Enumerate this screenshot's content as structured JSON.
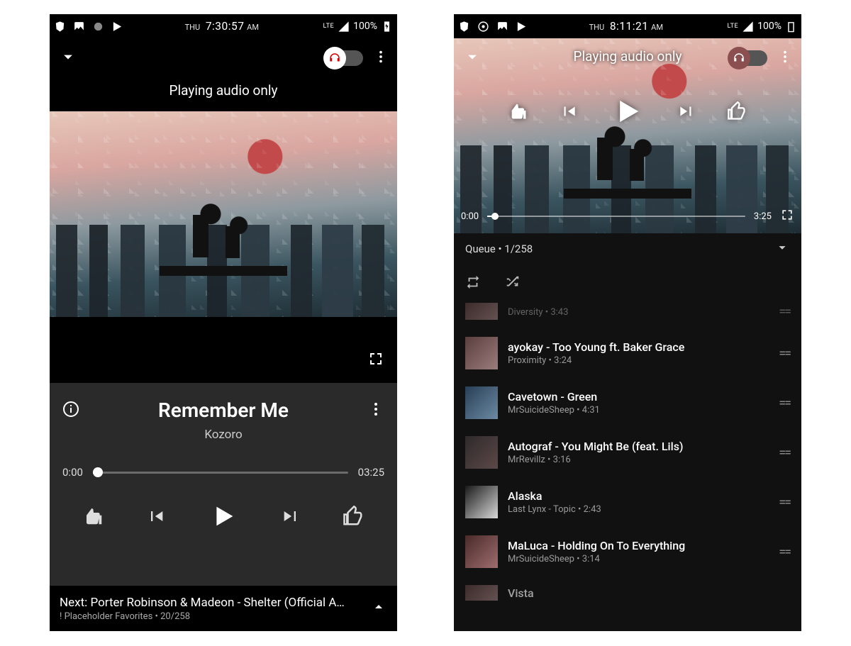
{
  "left": {
    "status": {
      "day": "THU",
      "time": "7:30:57",
      "ampm": "AM",
      "net": "LTE",
      "battery": "100%"
    },
    "audio_only": "Playing audio only",
    "song_title": "Remember Me",
    "artist": "Kozoro",
    "time_current": "0:00",
    "time_duration": "03:25",
    "next_line1": "Next: Porter Robinson & Madeon - Shelter (Official A…",
    "next_line2": "! Placeholder Favorites • 20/258"
  },
  "right": {
    "status": {
      "day": "THU",
      "time": "8:11:21",
      "ampm": "AM",
      "net": "LTE",
      "battery": "100%"
    },
    "audio_only": "Playing audio only",
    "time_current": "0:00",
    "time_duration": "3:25",
    "queue_label": "Queue • 1/258",
    "items": [
      {
        "title_partial": "Diversity • 3:43"
      },
      {
        "title": "ayokay - Too Young ft. Baker Grace",
        "sub": "Proximity • 3:24"
      },
      {
        "title": "Cavetown - Green",
        "sub": "MrSuicideSheep • 4:31"
      },
      {
        "title": "Autograf - You Might Be (feat. Lils)",
        "sub": "MrRevillz • 3:16"
      },
      {
        "title": "Alaska",
        "sub": "Last Lynx - Topic • 2:43"
      },
      {
        "title": "MaLuca - Holding On To Everything",
        "sub": "MrSuicideSheep • 3:14"
      },
      {
        "title_partial": "Vista"
      }
    ]
  }
}
